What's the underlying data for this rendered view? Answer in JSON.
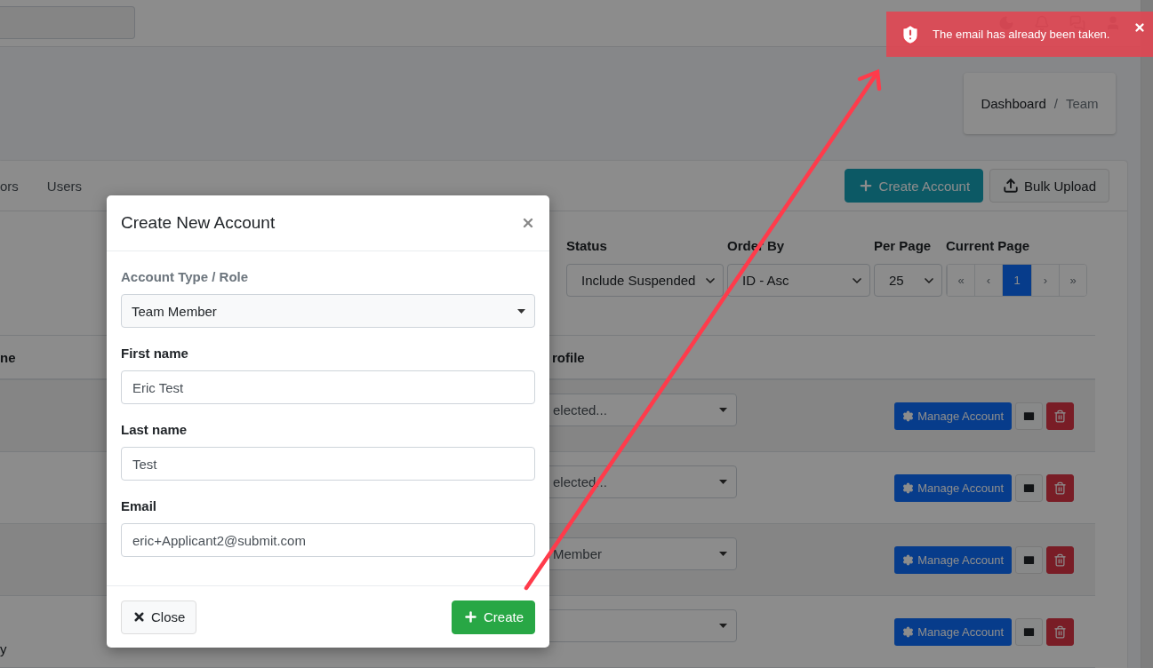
{
  "toast": {
    "message": "The email has already been taken."
  },
  "breadcrumb": {
    "separator": "/",
    "items": [
      {
        "label": "Dashboard",
        "active": false
      },
      {
        "label": "Team",
        "active": true
      }
    ]
  },
  "tabs": [
    {
      "label": "ors",
      "selected": false
    },
    {
      "label": "Users",
      "selected": false
    }
  ],
  "header_buttons": [
    {
      "kind": "create",
      "label": "Create Account"
    },
    {
      "kind": "upload",
      "label": "Bulk Upload"
    }
  ],
  "filters": [
    {
      "label": "Status",
      "value": "Include Suspended"
    },
    {
      "label": "Order By",
      "value": "ID - Asc"
    },
    {
      "label": "Per Page",
      "value": "25"
    }
  ],
  "pagination": {
    "label": "Current Page",
    "pages": [
      {
        "label": "«",
        "selected": false
      },
      {
        "label": "‹",
        "selected": false
      },
      {
        "label": "1",
        "selected": true
      },
      {
        "label": "›",
        "selected": false
      },
      {
        "label": "»",
        "selected": false
      }
    ]
  },
  "table": {
    "columns": [
      "ne",
      "rofile"
    ],
    "rows": [
      {
        "profile": "elected...",
        "action": "Manage Account"
      },
      {
        "profile": "elected...",
        "action": "Manage Account"
      },
      {
        "profile": "Member",
        "action": "Manage Account"
      },
      {
        "name": "y",
        "action": "Manage Account"
      }
    ]
  },
  "modal": {
    "title": "Create New Account",
    "role": {
      "label": "Account Type / Role",
      "value": "Team Member"
    },
    "fields": [
      {
        "label": "First name",
        "value": "Eric Test"
      },
      {
        "label": "Last name",
        "value": "Test"
      },
      {
        "label": "Email",
        "value": "eric+Applicant2@submit.com"
      }
    ],
    "buttons": [
      {
        "kind": "close",
        "label": "Close"
      },
      {
        "kind": "create",
        "label": "Create"
      }
    ]
  }
}
